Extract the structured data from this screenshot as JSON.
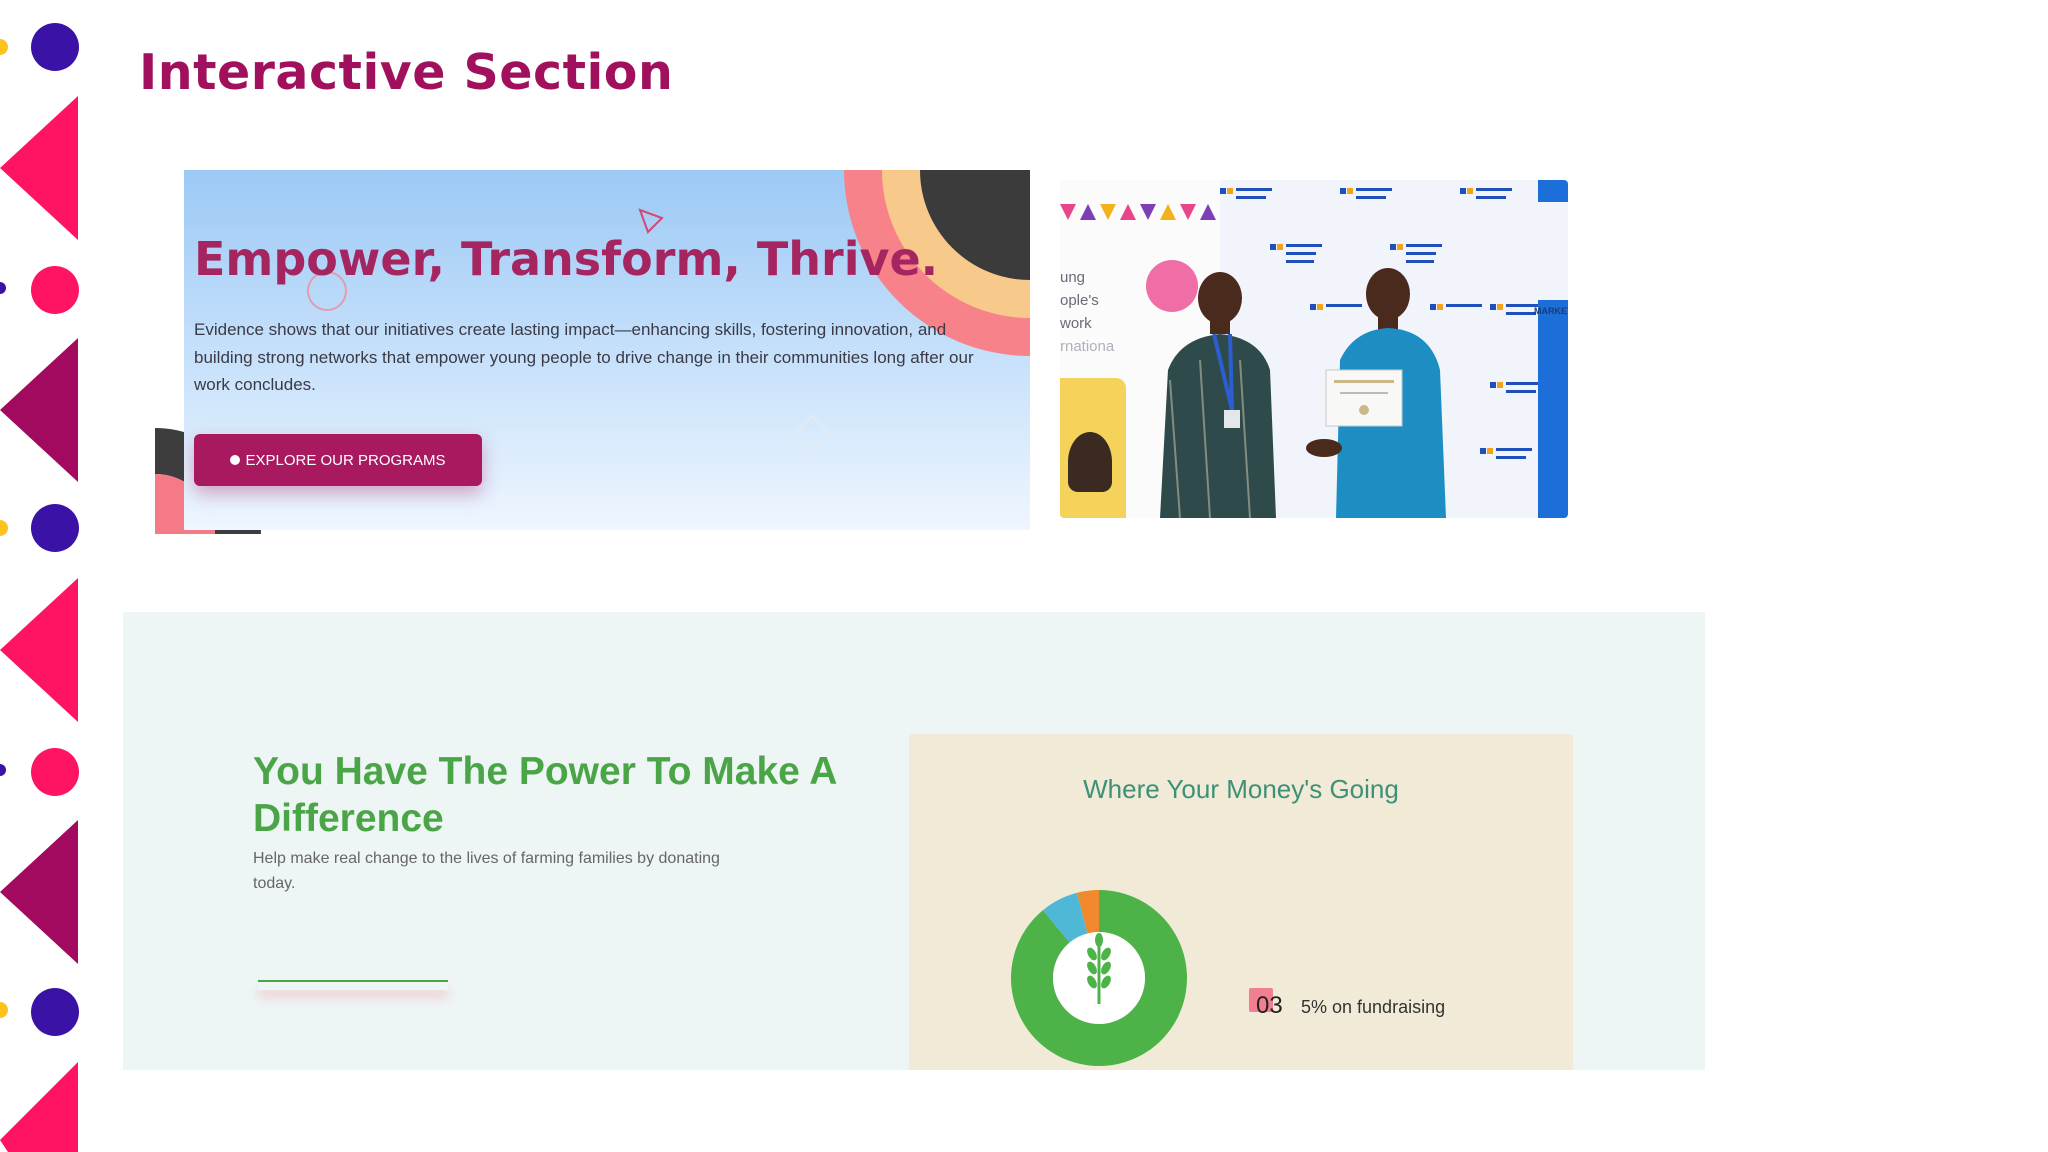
{
  "page": {
    "title": "Interactive Section"
  },
  "hero": {
    "title": "Empower, Transform, Thrive.",
    "body": "Evidence shows that our initiatives create lasting impact—enhancing skills, fostering innovation, and building strong networks that empower young people to drive change in their communities long after our work concludes.",
    "button_label": "EXPLORE OUR PROGRAMS"
  },
  "photo": {
    "backdrop_partial_lines": [
      "ung",
      "ople's",
      "work",
      "rnationa"
    ],
    "banner_word": "MARKET"
  },
  "donate": {
    "title": "You Have The Power To Make A Difference",
    "subtitle": "Help make real change to the lives of farming families by donating today."
  },
  "money": {
    "title": "Where Your Money's Going",
    "legend_number": "03",
    "legend_text": "5% on fundraising"
  },
  "chart_data": {
    "type": "pie",
    "values": [
      89,
      7,
      4
    ],
    "colors": [
      "#4db348",
      "#4fb8d6",
      "#f08a2c"
    ]
  },
  "colors": {
    "brand_magenta": "#a0105c",
    "green": "#4aa547",
    "decor_pink": "#ff1463",
    "decor_purple": "#3b12a6",
    "decor_yellow": "#ffc21a"
  }
}
